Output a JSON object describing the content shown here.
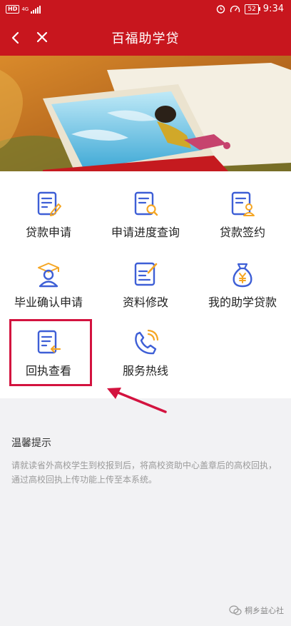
{
  "status": {
    "hd": "HD",
    "net": "4G",
    "battery": "52",
    "time": "9:34"
  },
  "nav": {
    "title": "百福助学贷",
    "back_icon": "chevron-left-icon",
    "close_icon": "close-icon"
  },
  "colors": {
    "header": "#c8161e",
    "icon_blue": "#3e5fd6",
    "icon_orange": "#f5a623",
    "highlight": "#d3133f"
  },
  "menu": [
    {
      "label": "贷款申请",
      "icon": "edit-document-icon",
      "interactable": true
    },
    {
      "label": "申请进度查询",
      "icon": "search-document-icon",
      "interactable": true
    },
    {
      "label": "贷款签约",
      "icon": "contract-user-icon",
      "interactable": true
    },
    {
      "label": "毕业确认申请",
      "icon": "graduate-icon",
      "interactable": true
    },
    {
      "label": "资料修改",
      "icon": "edit-square-icon",
      "interactable": true
    },
    {
      "label": "我的助学贷款",
      "icon": "money-bag-icon",
      "interactable": true
    },
    {
      "label": "回执查看",
      "icon": "receipt-return-icon",
      "interactable": true
    },
    {
      "label": "服务热线",
      "icon": "phone-icon",
      "interactable": true
    }
  ],
  "tips": {
    "title": "温馨提示",
    "body": "请就读省外高校学生到校报到后，将高校资助中心盖章后的高校回执，通过高校回执上传功能上传至本系统。"
  },
  "watermark": {
    "text": "桐乡益心社"
  }
}
